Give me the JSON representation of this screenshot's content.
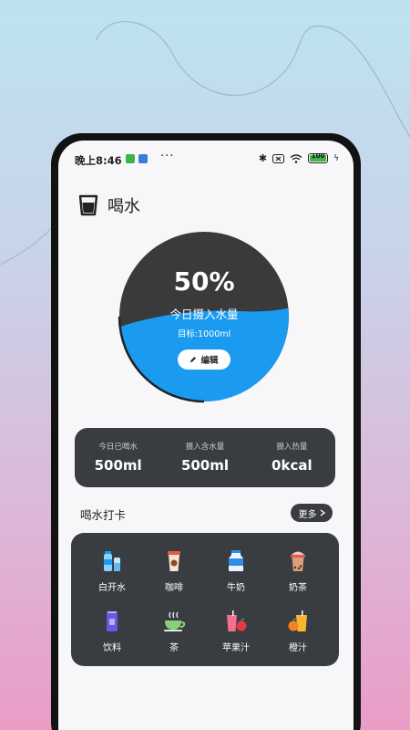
{
  "status_bar": {
    "time": "晚上8:46",
    "more": "···",
    "battery": "100"
  },
  "header": {
    "title": "喝水",
    "icon": "water-cup-icon"
  },
  "gauge": {
    "percent_text": "50%",
    "percent_value": 0.5,
    "subtitle": "今日摄入水量",
    "target": "目标:1000ml",
    "edit_label": "编辑",
    "water_color": "#1a9bf0",
    "empty_color": "#3a3a3a"
  },
  "stats": [
    {
      "label": "今日已喝水",
      "value": "500ml"
    },
    {
      "label": "摄入含水量",
      "value": "500ml"
    },
    {
      "label": "摄入热量",
      "value": "0kcal"
    }
  ],
  "checkin": {
    "title": "喝水打卡",
    "more_label": "更多"
  },
  "drinks": [
    {
      "label": "白开水",
      "icon": "water-bottle-icon"
    },
    {
      "label": "咖啡",
      "icon": "coffee-cup-icon"
    },
    {
      "label": "牛奶",
      "icon": "milk-carton-icon"
    },
    {
      "label": "奶茶",
      "icon": "milk-tea-icon"
    },
    {
      "label": "饮料",
      "icon": "soda-can-icon"
    },
    {
      "label": "茶",
      "icon": "tea-cup-icon"
    },
    {
      "label": "苹果汁",
      "icon": "apple-juice-icon"
    },
    {
      "label": "橙汁",
      "icon": "orange-juice-icon"
    }
  ],
  "colors": {
    "dark_card": "#393d42",
    "accent_blue": "#1a9bf0"
  }
}
